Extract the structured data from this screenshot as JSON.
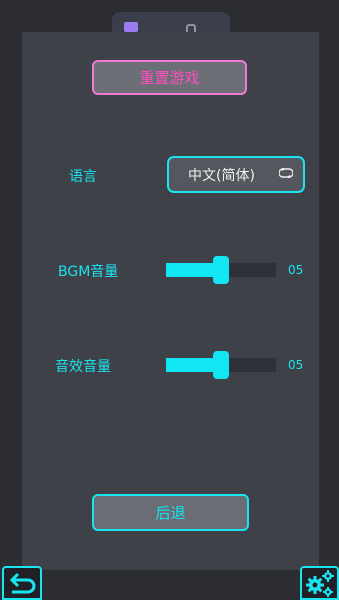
{
  "colors": {
    "accent_cyan": "#19e5f0",
    "accent_pink": "#ff4fc3",
    "panel": "#3f4148",
    "background": "#2b2d33"
  },
  "settings": {
    "reset_label": "重置游戏",
    "language_label": "语言",
    "language_value": "中文(简体)",
    "language_icon": "cycle-icon",
    "bgm_label": "BGM音量",
    "bgm_value_text": "05",
    "bgm_level": 0.5,
    "sfx_label": "音效音量",
    "sfx_value_text": "05",
    "sfx_level": 0.5,
    "back_label": "后退"
  },
  "corners": {
    "left_icon": "back-arrow-icon",
    "right_icon": "gears-icon"
  }
}
